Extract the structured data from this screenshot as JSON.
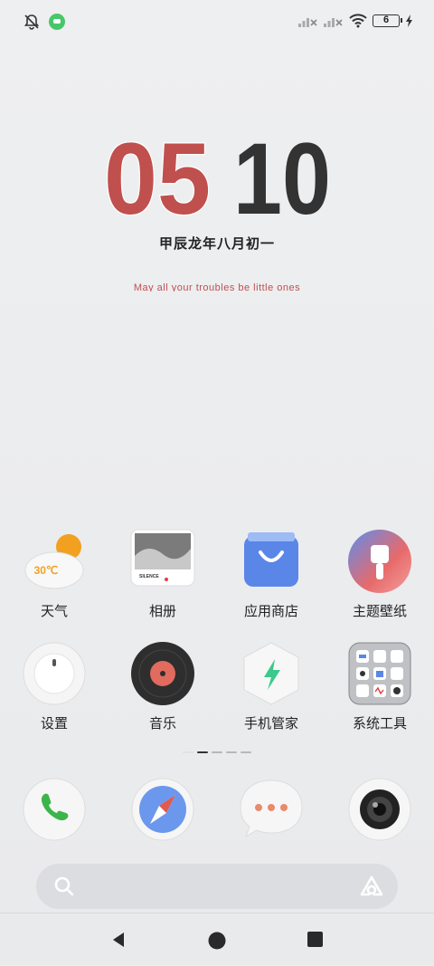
{
  "status_bar": {
    "battery_level": "6",
    "icons": [
      "bell-off-icon",
      "app-notification-icon",
      "signal-x-icon",
      "signal-x-icon",
      "wifi-icon",
      "battery-icon",
      "charging-bolt-icon"
    ]
  },
  "clock": {
    "hour": "05",
    "minute": "10",
    "hour_color": "#c0504d",
    "minute_color": "#333333"
  },
  "lunar_date": "甲辰龙年八月初一",
  "quote": "May all your troubles be little ones",
  "apps_row1": [
    {
      "label": "天气",
      "icon": "weather-icon",
      "temp": "30℃"
    },
    {
      "label": "相册",
      "icon": "gallery-icon",
      "caption": "SILENCE"
    },
    {
      "label": "应用商店",
      "icon": "app-store-icon"
    },
    {
      "label": "主题壁纸",
      "icon": "theme-wallpaper-icon"
    }
  ],
  "apps_row2": [
    {
      "label": "设置",
      "icon": "settings-icon"
    },
    {
      "label": "音乐",
      "icon": "music-icon"
    },
    {
      "label": "手机管家",
      "icon": "phone-manager-icon"
    },
    {
      "label": "系统工具",
      "icon": "system-tools-folder-icon"
    }
  ],
  "page_indicator": {
    "pages": 5,
    "active": 1
  },
  "dock": [
    {
      "icon": "phone-icon"
    },
    {
      "icon": "browser-compass-icon"
    },
    {
      "icon": "messages-icon"
    },
    {
      "icon": "camera-icon"
    }
  ],
  "search_bar": {
    "icon": "search-icon",
    "assistant_icon": "assistant-icon"
  },
  "nav_bar": {
    "buttons": [
      "back-button",
      "home-button",
      "recents-button"
    ]
  }
}
